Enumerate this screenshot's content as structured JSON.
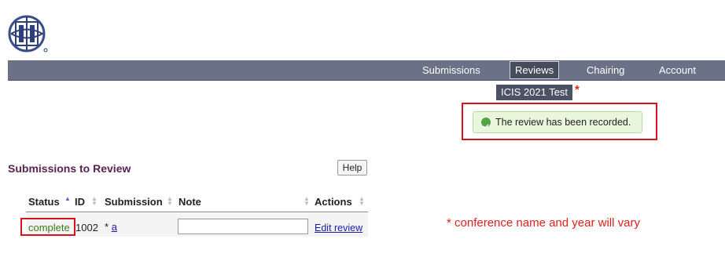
{
  "nav": {
    "items": [
      {
        "label": "Submissions"
      },
      {
        "label": "Reviews"
      },
      {
        "label": "Chairing"
      },
      {
        "label": "Account"
      }
    ],
    "dropdown_label": "ICIS 2021 Test"
  },
  "notice": {
    "text": "The review has been recorded.",
    "icon": "check-circle-icon"
  },
  "section": {
    "title": "Submissions to Review",
    "help_label": "Help"
  },
  "table": {
    "headers": [
      "Status",
      "ID",
      "Submission",
      "Note",
      "Actions"
    ],
    "rows": [
      {
        "status": "complete",
        "id": "1002",
        "marker": "*",
        "submission": "a",
        "note": "",
        "action": "Edit review"
      }
    ]
  },
  "annotations": {
    "star": "*",
    "note": "* conference name and year will vary"
  },
  "colors": {
    "topbar": "#6b7287",
    "highlight": "#d8131b",
    "annotation": "#e0201a"
  }
}
